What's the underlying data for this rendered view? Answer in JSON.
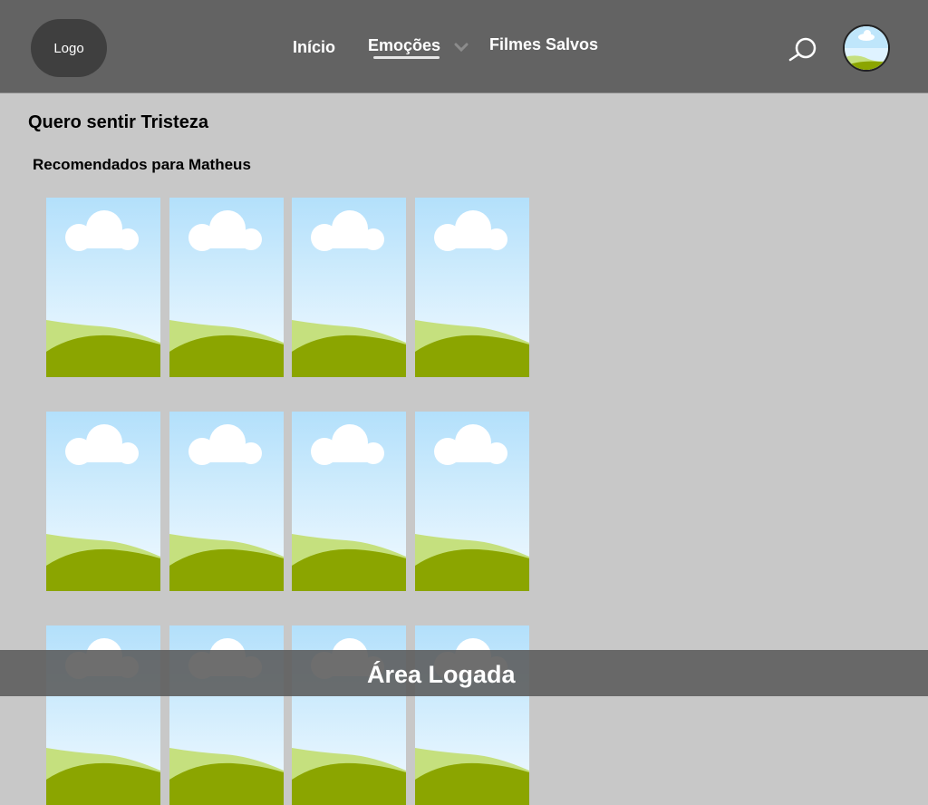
{
  "header": {
    "logo": "Logo",
    "nav": [
      {
        "label": "Início"
      },
      {
        "label": "Emoções"
      },
      {
        "label": "Filmes Salvos"
      }
    ],
    "icons": {
      "dropdown": "chevron-down-icon",
      "search": "search-icon",
      "avatar": "avatar-image"
    }
  },
  "main": {
    "page_title": "Quero sentir Tristeza",
    "section_title": "Recomendados para Matheus",
    "rows": 3,
    "posters_per_row": 4
  },
  "footer": {
    "label": "Área Logada"
  },
  "colors": {
    "header_bg": "#636363",
    "page_bg": "#c8c8c8",
    "logo_bg": "#3f3f3f",
    "sky_top": "#b3e0fb",
    "grass_light": "#c5e07e",
    "grass_dark": "#8ba500"
  }
}
